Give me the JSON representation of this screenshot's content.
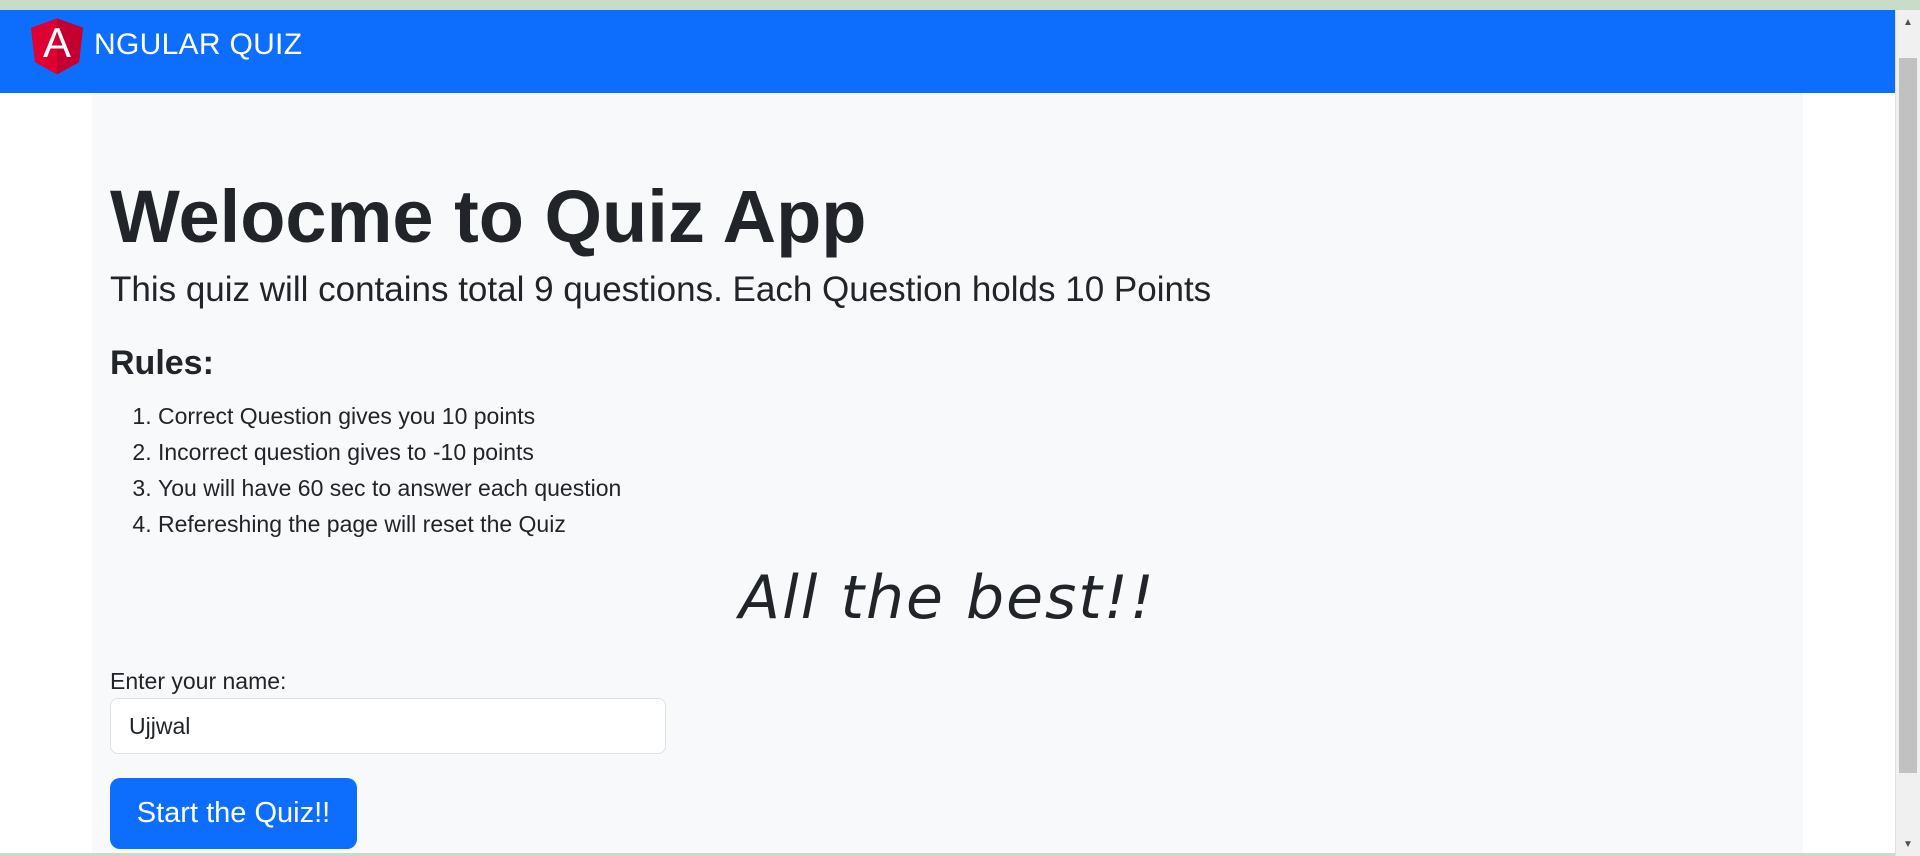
{
  "navbar": {
    "logo_letter": "A",
    "brand_text": "NGULAR QUIZ",
    "color": "#0d6efd"
  },
  "main": {
    "title": "Welocme to Quiz App",
    "subtitle": "This quiz will contains total 9 questions. Each Question holds 10 Points",
    "rules_heading": "Rules:",
    "rules": [
      "Correct Question gives you 10 points",
      "Incorrect question gives to -10 points",
      "You will have 60 sec to answer each question",
      "Refereshing the page will reset the Quiz"
    ],
    "best_wishes": "All the best!!",
    "name_label": "Enter your name:",
    "name_value": "Ujjwal",
    "start_button": "Start the Quiz!!"
  },
  "colors": {
    "primary": "#0d6efd",
    "container_bg": "#f8f9fa",
    "text": "#212529",
    "logo_red": "#dd0031",
    "logo_dark_red": "#c3002f"
  },
  "icons": {
    "logo": "angular-shield-icon",
    "scroll_up": "triangle-up-icon",
    "scroll_down": "triangle-down-icon"
  }
}
